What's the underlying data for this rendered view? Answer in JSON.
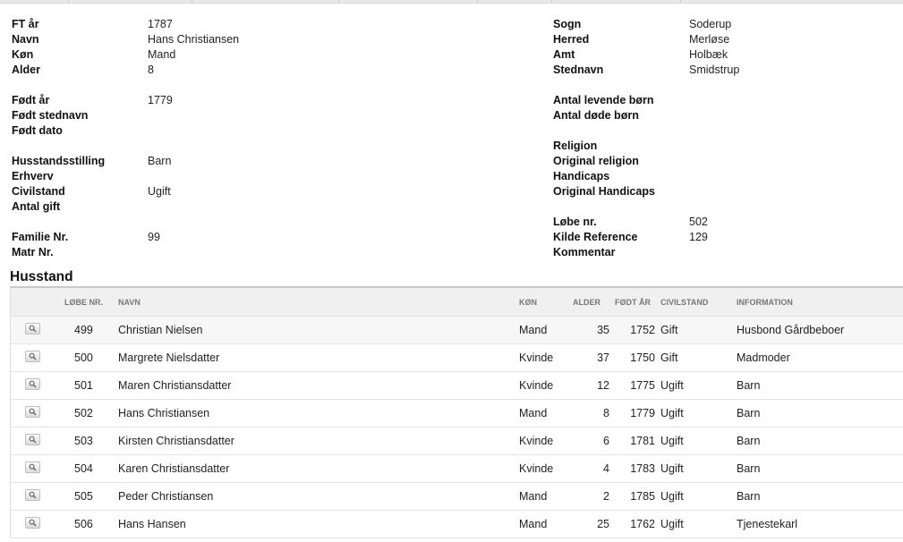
{
  "person_left": [
    {
      "label": "FT år",
      "value": "1787"
    },
    {
      "label": "Navn",
      "value": "Hans Christiansen"
    },
    {
      "label": "Køn",
      "value": "Mand"
    },
    {
      "label": "Alder",
      "value": "8"
    },
    {
      "label": "Født år",
      "value": "1779"
    },
    {
      "label": "Født stednavn",
      "value": ""
    },
    {
      "label": "Født dato",
      "value": ""
    },
    {
      "label": "Husstandsstilling",
      "value": "Barn"
    },
    {
      "label": "Erhverv",
      "value": ""
    },
    {
      "label": "Civilstand",
      "value": "Ugift"
    },
    {
      "label": "Antal gift",
      "value": ""
    },
    {
      "label": "Familie Nr.",
      "value": "99"
    },
    {
      "label": "Matr Nr.",
      "value": ""
    }
  ],
  "person_right": [
    {
      "label": "Sogn",
      "value": "Soderup"
    },
    {
      "label": "Herred",
      "value": "Merløse"
    },
    {
      "label": "Amt",
      "value": "Holbæk"
    },
    {
      "label": "Stednavn",
      "value": "Smidstrup"
    },
    {
      "label": "Antal levende børn",
      "value": ""
    },
    {
      "label": "Antal døde børn",
      "value": ""
    },
    {
      "label": "Religion",
      "value": ""
    },
    {
      "label": "Original religion",
      "value": ""
    },
    {
      "label": "Handicaps",
      "value": ""
    },
    {
      "label": "Original Handicaps",
      "value": ""
    },
    {
      "label": "Løbe nr.",
      "value": "502"
    },
    {
      "label": "Kilde Reference",
      "value": "129"
    },
    {
      "label": "Kommentar",
      "value": ""
    }
  ],
  "household": {
    "title": "Husstand",
    "columns": {
      "lobe": "Løbe nr.",
      "navn": "Navn",
      "kon": "Køn",
      "alder": "Alder",
      "fodt": "Født år",
      "civilstand": "Civilstand",
      "information": "Information"
    },
    "rows": [
      {
        "lobe": "499",
        "navn": "Christian Nielsen",
        "kon": "Mand",
        "alder": "35",
        "fodt": "1752",
        "civilstand": "Gift",
        "information": "Husbond Gårdbeboer"
      },
      {
        "lobe": "500",
        "navn": "Margrete Nielsdatter",
        "kon": "Kvinde",
        "alder": "37",
        "fodt": "1750",
        "civilstand": "Gift",
        "information": "Madmoder"
      },
      {
        "lobe": "501",
        "navn": "Maren Christiansdatter",
        "kon": "Kvinde",
        "alder": "12",
        "fodt": "1775",
        "civilstand": "Ugift",
        "information": "Barn"
      },
      {
        "lobe": "502",
        "navn": "Hans Christiansen",
        "kon": "Mand",
        "alder": "8",
        "fodt": "1779",
        "civilstand": "Ugift",
        "information": "Barn"
      },
      {
        "lobe": "503",
        "navn": "Kirsten Christiansdatter",
        "kon": "Kvinde",
        "alder": "6",
        "fodt": "1781",
        "civilstand": "Ugift",
        "information": "Barn"
      },
      {
        "lobe": "504",
        "navn": "Karen Christiansdatter",
        "kon": "Kvinde",
        "alder": "4",
        "fodt": "1783",
        "civilstand": "Ugift",
        "information": "Barn"
      },
      {
        "lobe": "505",
        "navn": "Peder Christiansen",
        "kon": "Mand",
        "alder": "2",
        "fodt": "1785",
        "civilstand": "Ugift",
        "information": "Barn"
      },
      {
        "lobe": "506",
        "navn": "Hans Hansen",
        "kon": "Mand",
        "alder": "25",
        "fodt": "1762",
        "civilstand": "Ugift",
        "information": "Tjenestekarl"
      }
    ]
  },
  "icons": {
    "row_action": "magnifier-icon"
  }
}
